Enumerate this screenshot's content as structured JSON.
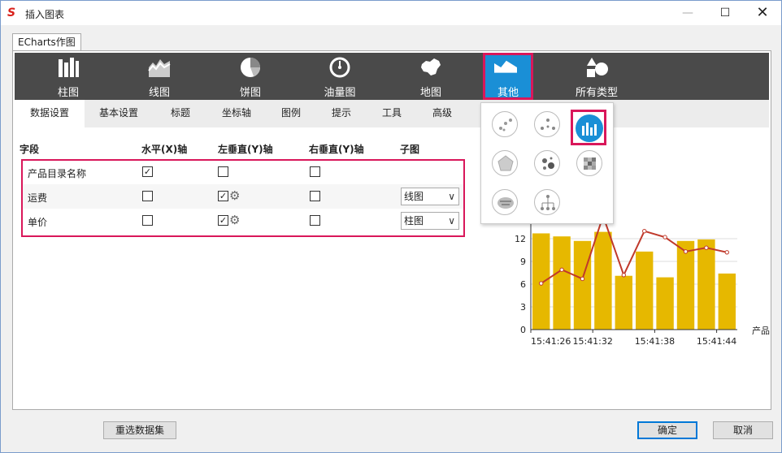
{
  "window": {
    "title": "插入图表"
  },
  "outer_tab": "ECharts作图",
  "toolbar": {
    "items": [
      {
        "label": "柱图",
        "icon": "bar-chart-icon"
      },
      {
        "label": "线图",
        "icon": "line-chart-icon"
      },
      {
        "label": "饼图",
        "icon": "pie-chart-icon"
      },
      {
        "label": "油量图",
        "icon": "gauge-icon"
      },
      {
        "label": "地图",
        "icon": "map-icon"
      },
      {
        "label": "其他",
        "icon": "other-chart-icon"
      },
      {
        "label": "所有类型",
        "icon": "all-types-icon"
      }
    ]
  },
  "subtabs": [
    "数据设置",
    "基本设置",
    "标题",
    "坐标轴",
    "图例",
    "提示",
    "工具",
    "高级"
  ],
  "grid": {
    "headers": [
      "字段",
      "水平(X)轴",
      "左垂直(Y)轴",
      "右垂直(Y)轴",
      "子图"
    ],
    "rows": [
      {
        "field": "产品目录名称",
        "x": true,
        "left_y": false,
        "right_y": false,
        "subchart": ""
      },
      {
        "field": "运费",
        "x": false,
        "left_y": true,
        "right_y": false,
        "subchart": "线图"
      },
      {
        "field": "单价",
        "x": false,
        "left_y": true,
        "right_y": false,
        "subchart": "柱图"
      }
    ]
  },
  "popup_icons": [
    "scatter-icon",
    "radial-scatter-icon",
    "mixed-bar-line-icon",
    "radar-icon",
    "bubble-icon",
    "heatmap-icon",
    "wordcloud-icon",
    "tree-icon"
  ],
  "chart_data": {
    "type": "bar",
    "categories": [
      "15:41:26",
      "",
      "15:41:32",
      "",
      "",
      "15:41:38",
      "",
      "",
      "15:41:44",
      ""
    ],
    "series": [
      {
        "type": "bar",
        "values": [
          12.7,
          12.3,
          11.7,
          12.9,
          7.1,
          10.3,
          6.9,
          11.7,
          11.9,
          7.4
        ]
      },
      {
        "type": "line",
        "values": [
          6.1,
          7.9,
          6.7,
          15.0,
          7.2,
          13.0,
          12.2,
          10.3,
          10.8,
          10.2
        ]
      }
    ],
    "y_ticks": [
      0,
      3,
      6,
      9,
      12
    ],
    "x_tick_labels": [
      "15:41:26",
      "15:41:32",
      "15:41:38",
      "15:41:44"
    ],
    "x_axis_label_partial": "产品",
    "ylim": [
      0,
      15
    ],
    "bar_color": "#e6b800",
    "line_color": "#c0392b"
  },
  "buttons": {
    "reselect": "重选数据集",
    "ok": "确定",
    "cancel": "取消"
  },
  "colors": {
    "toolbar_bg": "#4a4a4a",
    "active_blue": "#1a8fd6",
    "highlight_red": "#d9175a"
  }
}
